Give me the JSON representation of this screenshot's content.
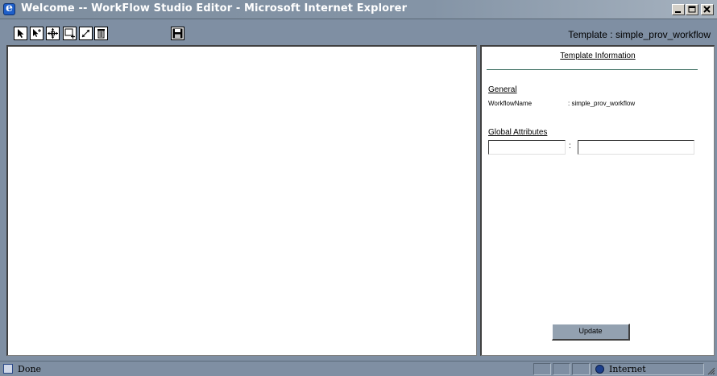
{
  "window": {
    "title": "Welcome -- WorkFlow Studio Editor - Microsoft Internet Explorer"
  },
  "toolbar": {
    "tools": [
      {
        "name": "select-pointer-icon"
      },
      {
        "name": "add-pointer-icon"
      },
      {
        "name": "move-icon"
      },
      {
        "name": "add-node-icon"
      },
      {
        "name": "connect-icon"
      },
      {
        "name": "delete-trash-icon"
      },
      {
        "name": "save-floppy-icon"
      }
    ],
    "template_label": "Template : simple_prov_workflow"
  },
  "info_panel": {
    "title": "Template Information",
    "general_label": "General",
    "workflow_name_key": "WorkflowName",
    "workflow_name_value": ": simple_prov_workflow",
    "global_attributes_label": "Global Attributes",
    "attr_separator": ":",
    "attr_key_value": "",
    "attr_value_value": "",
    "update_label": "Update"
  },
  "status": {
    "text": "Done",
    "zone": "Internet"
  },
  "colors": {
    "chrome": "#7f8fa3",
    "titlebar_text": "#ffffff",
    "panel_rule": "#3c6e60"
  }
}
